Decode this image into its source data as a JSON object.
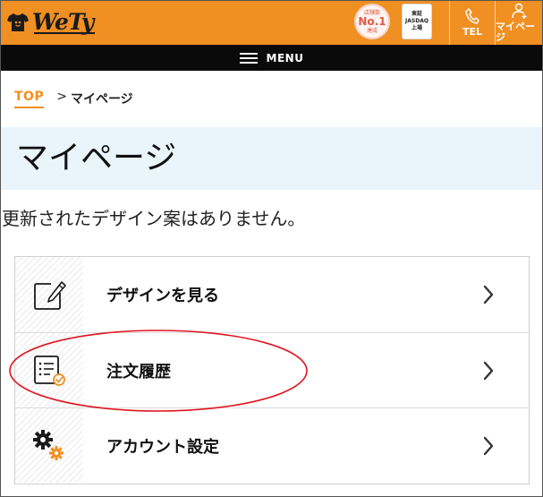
{
  "header": {
    "logo_text": "WeTy",
    "badge_no1": {
      "small_top": "店舗数",
      "main": "No.1",
      "small_bottom": "達成"
    },
    "badge_jasdaq": {
      "line1": "東証",
      "line2": "JASDAQ",
      "line3": "上場"
    },
    "tel_label": "TEL",
    "mypage_label": "マイページ"
  },
  "menubar": {
    "label": "MENU"
  },
  "breadcrumb": {
    "top": "TOP",
    "separator": ">",
    "current": "マイページ"
  },
  "page": {
    "title": "マイページ",
    "message": "更新されたデザイン案はありません。"
  },
  "menu_items": [
    {
      "label": "デザインを見る",
      "icon": "edit-icon"
    },
    {
      "label": "注文履歴",
      "icon": "order-history-icon"
    },
    {
      "label": "アカウント設定",
      "icon": "gears-icon"
    }
  ],
  "colors": {
    "brand_orange": "#f08f22",
    "menubar_black": "#0a0a0a",
    "title_bg": "#eaf5fb",
    "annotation_red": "#e0141e"
  }
}
